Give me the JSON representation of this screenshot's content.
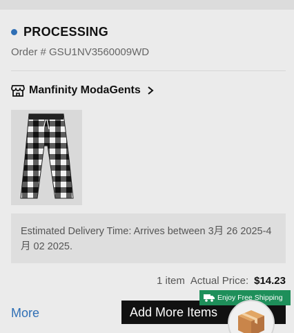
{
  "order": {
    "status": "PROCESSING",
    "order_number": "Order # GSU1NV3560009WD"
  },
  "store": {
    "name": "Manfinity ModaGents"
  },
  "delivery": {
    "text": "Estimated Delivery Time: Arrives between 3月 26 2025-4月 02 2025."
  },
  "summary": {
    "items": "1 item",
    "price_label": "Actual Price:",
    "price": "$14.23"
  },
  "actions": {
    "more": "More",
    "add_more": "Add More Items",
    "shipping_promo": "Enjoy Free Shipping"
  },
  "colors": {
    "status_dot": "#2f6fb5",
    "link": "#2f6fb5",
    "promo": "#1e8f5a",
    "button": "#111111"
  },
  "icons": [
    "store-icon",
    "chevron-right-icon",
    "truck-icon",
    "package-box-icon"
  ]
}
